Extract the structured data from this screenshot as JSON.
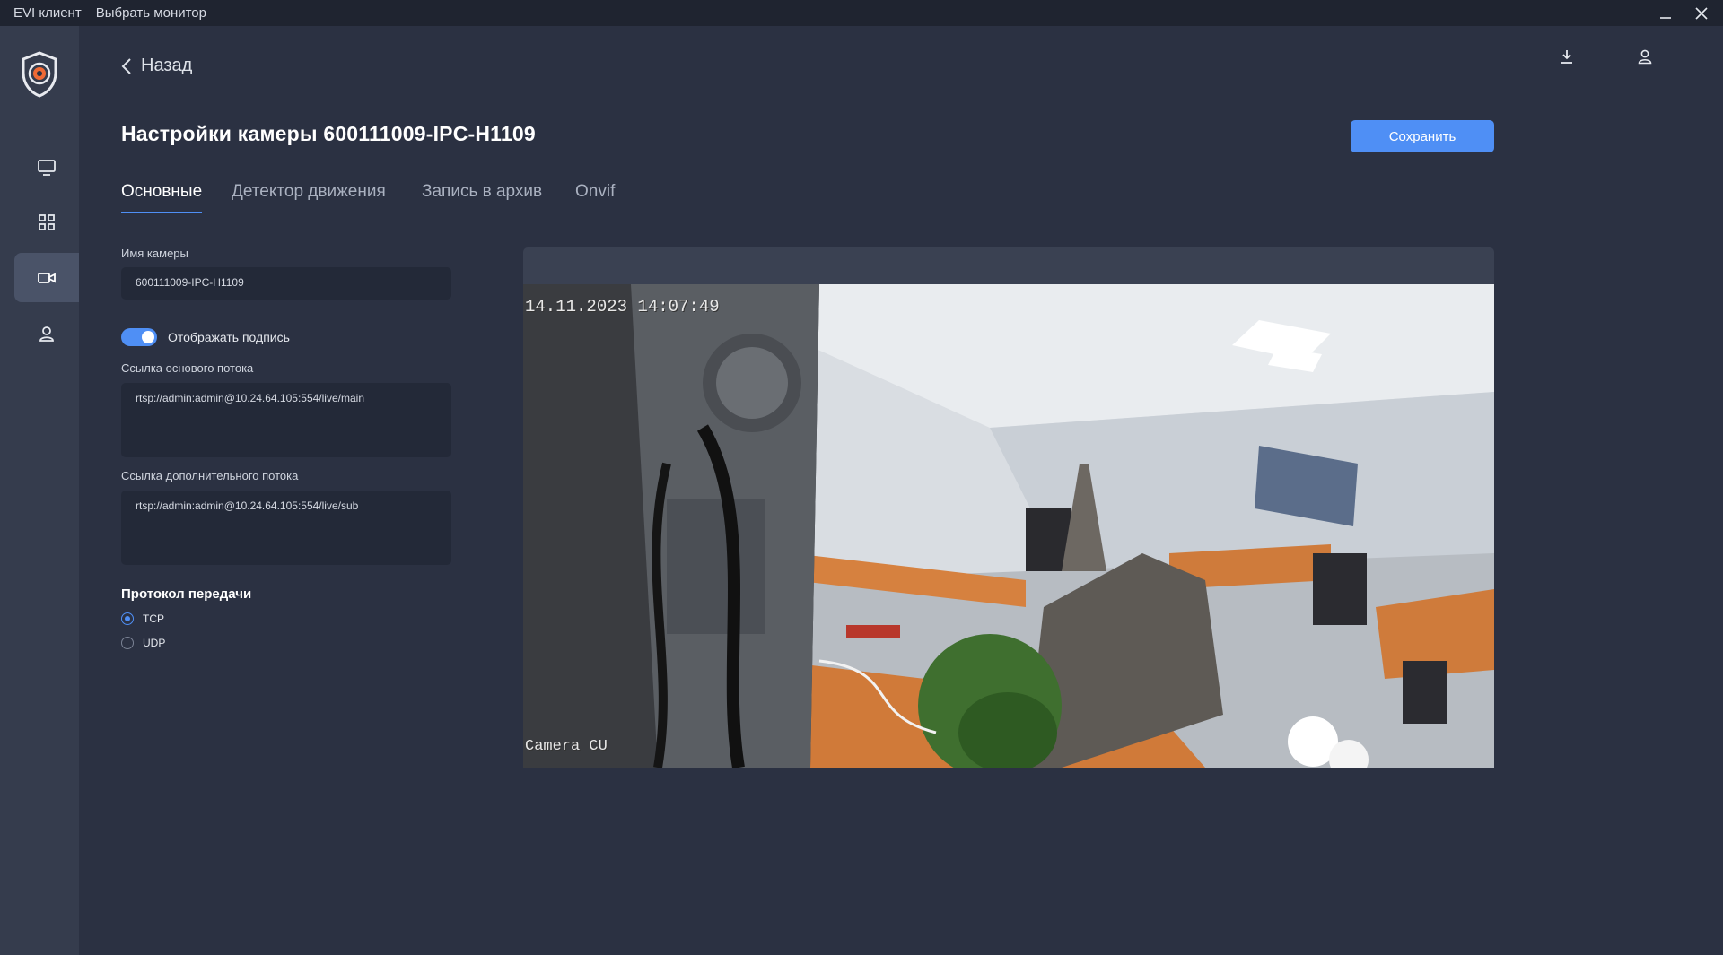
{
  "titlebar": {
    "app_name": "EVI клиент",
    "menu_monitor": "Выбрать монитор"
  },
  "sidebar": {
    "items": [
      {
        "name": "monitor",
        "icon": "monitor-icon",
        "active": false
      },
      {
        "name": "grid",
        "icon": "grid-icon",
        "active": false
      },
      {
        "name": "cameras",
        "icon": "camera-icon",
        "active": true
      },
      {
        "name": "users",
        "icon": "user-icon",
        "active": false
      }
    ]
  },
  "header": {
    "back_label": "Назад",
    "title": "Настройки камеры 600111009-IPC-H1109",
    "save_label": "Сохранить"
  },
  "tabs": [
    {
      "label": "Основные",
      "active": true
    },
    {
      "label": "Детектор движения",
      "active": false
    },
    {
      "label": "Запись в архив",
      "active": false
    },
    {
      "label": "Onvif",
      "active": false
    }
  ],
  "form": {
    "camera_name_label": "Имя камеры",
    "camera_name_value": "600111009-IPC-H1109",
    "show_caption_label": "Отображать подпись",
    "show_caption_on": true,
    "main_stream_label": "Ссылка основого потока",
    "main_stream_value": "rtsp://admin:admin@10.24.64.105:554/live/main",
    "sub_stream_label": "Ссылка дополнительного потока",
    "sub_stream_value": "rtsp://admin:admin@10.24.64.105:554/live/sub",
    "protocol_title": "Протокол передачи",
    "protocol_options": [
      {
        "label": "TCP",
        "checked": true
      },
      {
        "label": "UDP",
        "checked": false
      }
    ]
  },
  "preview": {
    "timestamp": "14.11.2023 14:07:49",
    "caption": "Camera CU"
  },
  "colors": {
    "accent": "#4f8ff5",
    "background": "#2b3142",
    "sidebar": "#353c4d",
    "input_bg": "#232938"
  }
}
